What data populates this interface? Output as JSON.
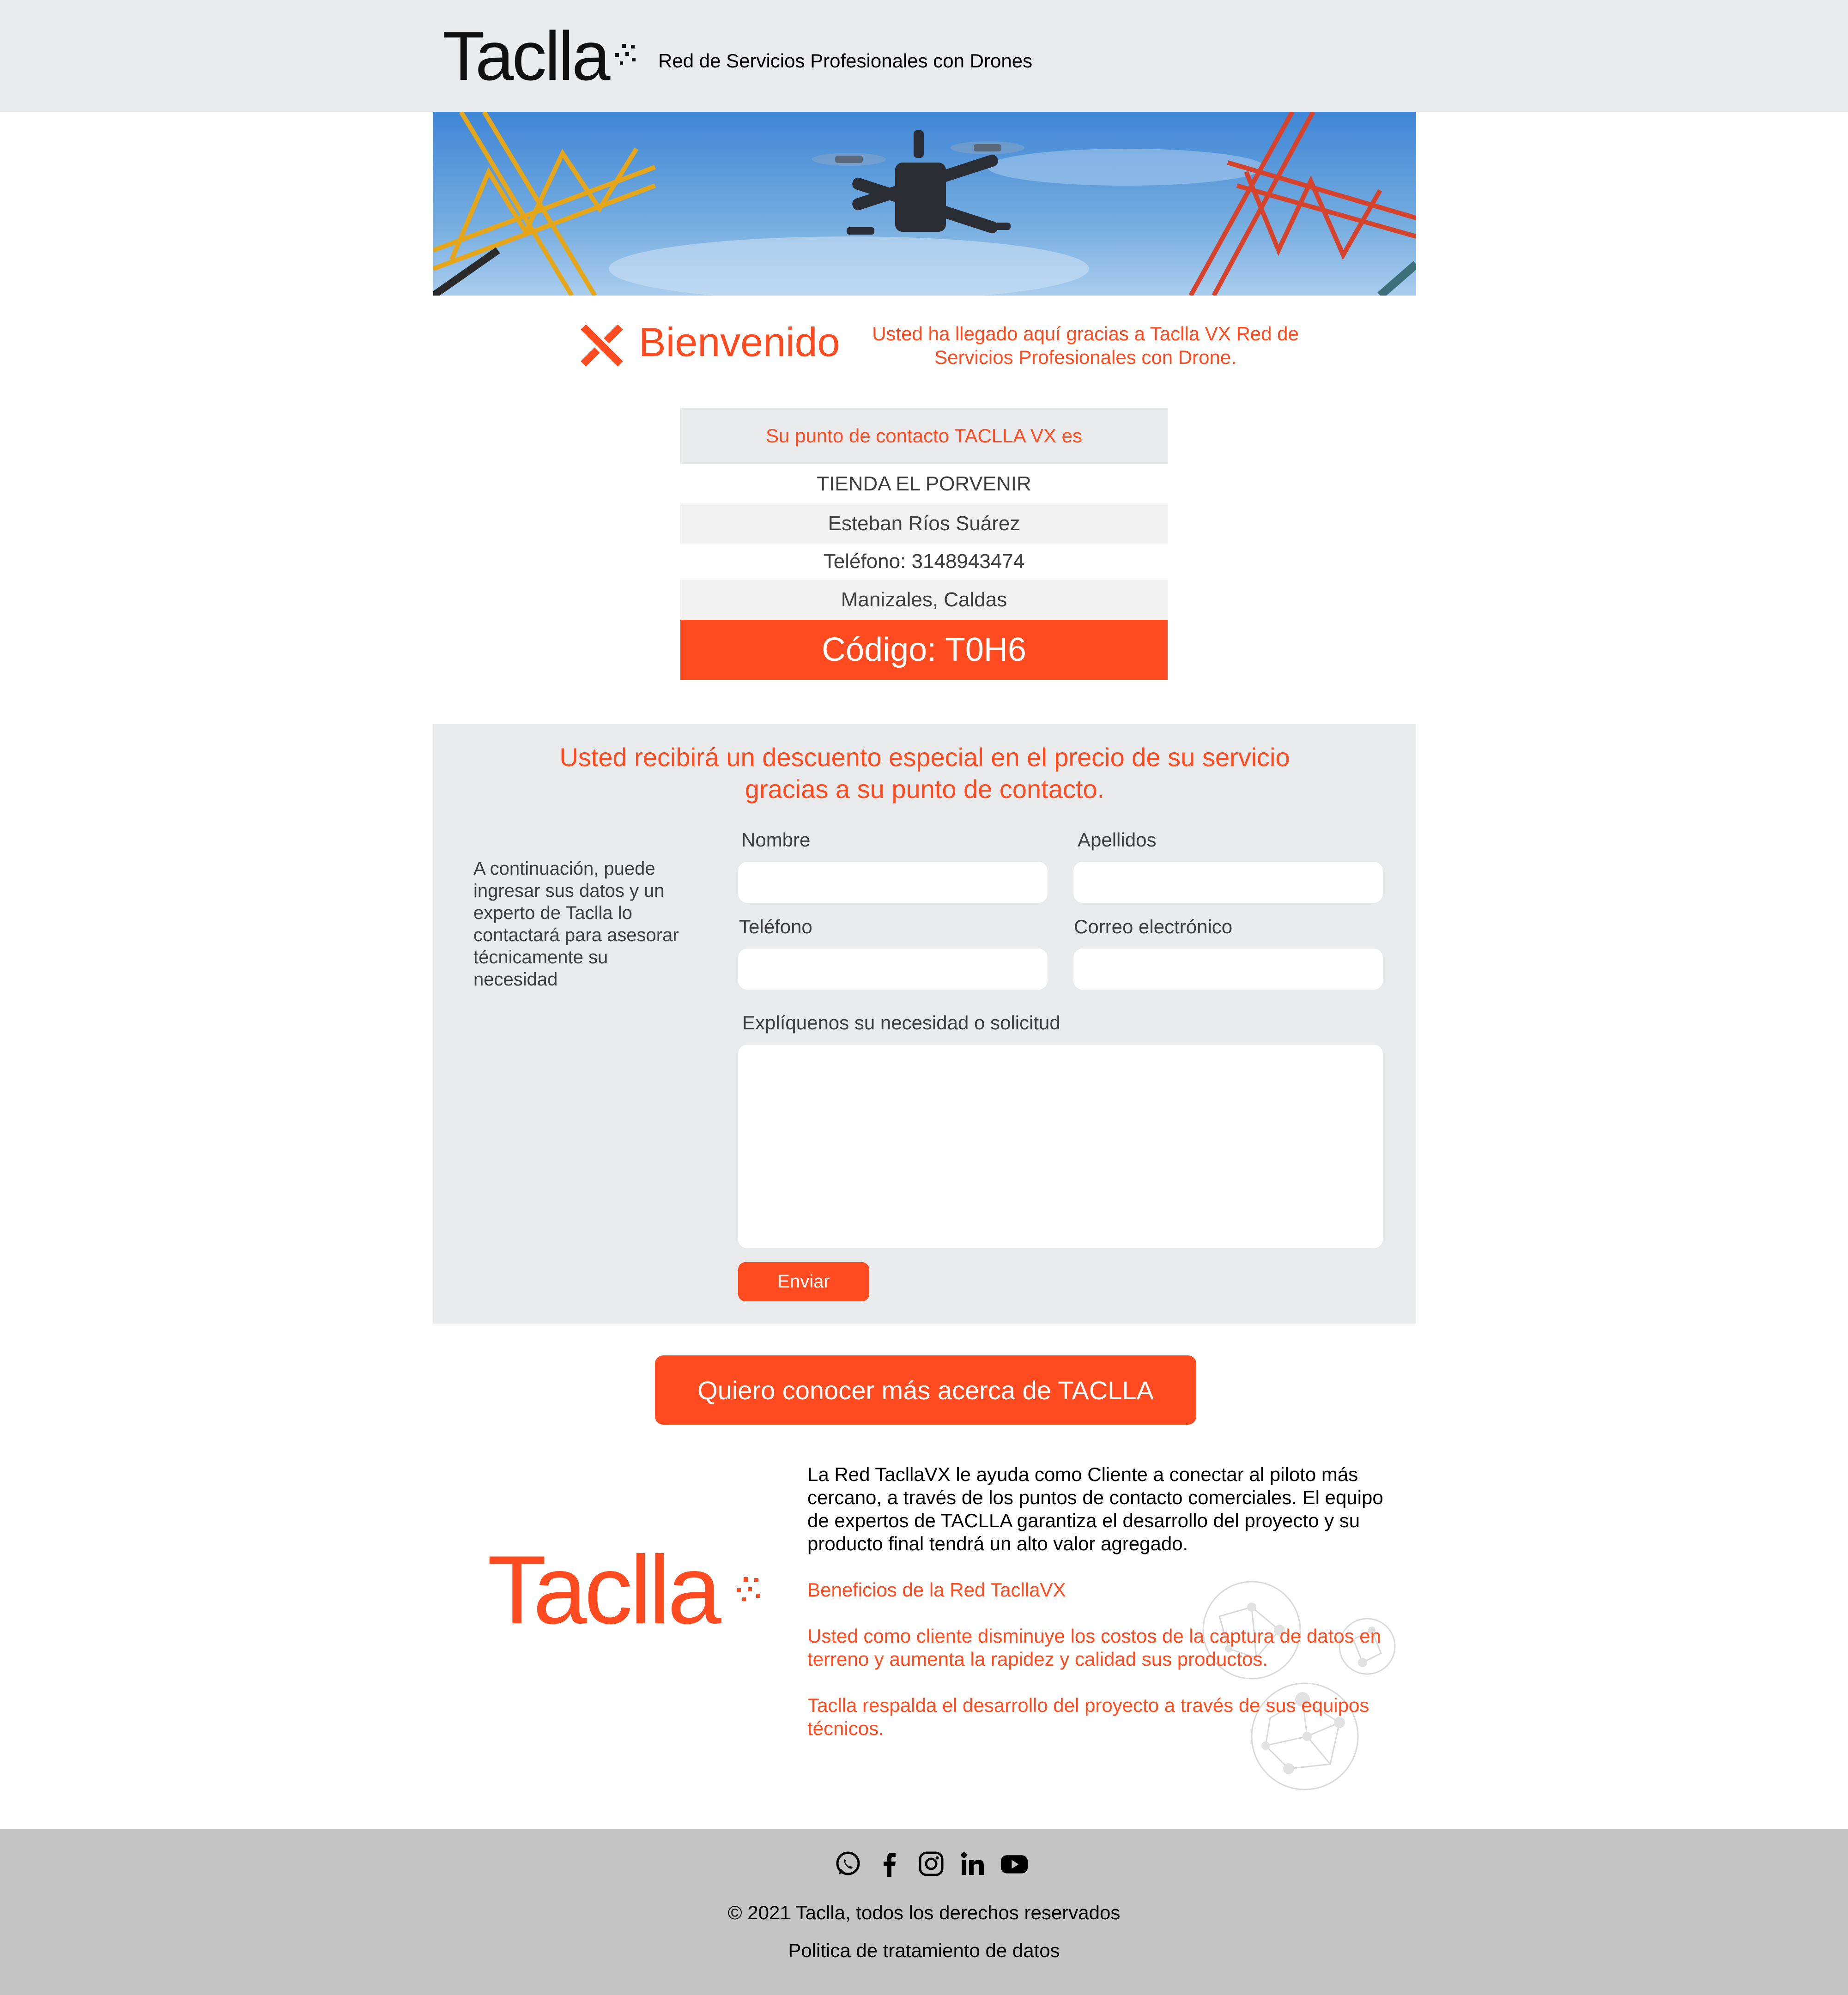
{
  "header": {
    "logo_text": "Taclla",
    "tagline": "Red de Servicios Profesionales con Drones"
  },
  "welcome": {
    "title": "Bienvenido",
    "text": "Usted ha llegado aquí gracias a Taclla VX Red de Servicios Profesionales con Drone."
  },
  "contact_card": {
    "heading": "Su punto de contacto TACLLA VX es",
    "store": "TIENDA EL PORVENIR",
    "person": "Esteban Ríos Suárez",
    "phone": "Teléfono: 3148943474",
    "city": "Manizales, Caldas",
    "code": "Código: T0H6"
  },
  "form": {
    "discount_line1": "Usted recibirá un descuento especial en el precio de su servicio",
    "discount_line2": "gracias a su punto de contacto.",
    "side_text": "A continuación, puede ingresar sus datos y un experto de Taclla lo contactará para asesorar técnicamente su necesidad",
    "nombre_label": "Nombre",
    "apellidos_label": "Apellidos",
    "telefono_label": "Teléfono",
    "correo_label": "Correo electrónico",
    "necesidad_label": "Explíquenos su necesidad o solicitud",
    "submit_label": "Enviar"
  },
  "cta_label": "Quiero conocer más acerca de TACLLA",
  "info": {
    "paragraph": "La Red TacllaVX le ayuda como Cliente a conectar al piloto más cercano, a través de los puntos de contacto comerciales. El equipo de expertos de TACLLA garantiza el desarrollo del proyecto y su producto final tendrá un alto valor agregado.",
    "benefits_title": "Beneficios de la Red TacllaVX",
    "benefit_1": "Usted como cliente disminuye los costos de la captura de datos en terreno y aumenta la rapidez y calidad sus productos.",
    "benefit_2": "Taclla respalda el desarrollo del proyecto a través de sus equipos técnicos."
  },
  "footer": {
    "copyright": "© 2021 Taclla, todos los derechos reservados",
    "policy": "Politica de tratamiento de datos",
    "social_icons": [
      "whatsapp-icon",
      "facebook-icon",
      "instagram-icon",
      "linkedin-icon",
      "youtube-icon"
    ]
  },
  "colors": {
    "accent": "#ff4b1f",
    "panel": "#e9eaec",
    "footer": "#c4c4c4"
  }
}
